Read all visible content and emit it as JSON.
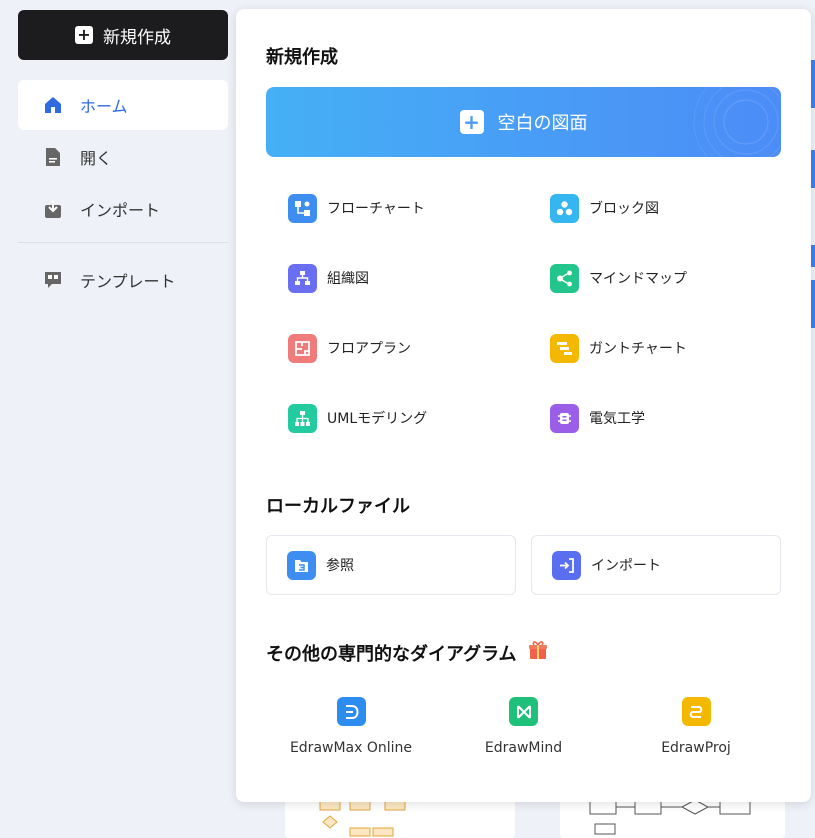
{
  "sidebar": {
    "new_button_label": "新規作成",
    "items": [
      {
        "label": "ホーム",
        "active": true
      },
      {
        "label": "開く"
      },
      {
        "label": "インポート"
      },
      {
        "label": "テンプレート"
      }
    ]
  },
  "panel": {
    "new_title": "新規作成",
    "blank_label": "空白の図面",
    "types": [
      {
        "label": "フローチャート",
        "icon": "flowchart-icon",
        "color": "#3d8ef0"
      },
      {
        "label": "ブロック図",
        "icon": "block-diagram-icon",
        "color": "#35b6f0"
      },
      {
        "label": "組織図",
        "icon": "org-chart-icon",
        "color": "#6a6ef0"
      },
      {
        "label": "マインドマップ",
        "icon": "mindmap-icon",
        "color": "#22c58b"
      },
      {
        "label": "フロアプラン",
        "icon": "floor-plan-icon",
        "color": "#f07b7b"
      },
      {
        "label": "ガントチャート",
        "icon": "gantt-icon",
        "color": "#f5b800"
      },
      {
        "label": "UMLモデリング",
        "icon": "uml-icon",
        "color": "#22cba0"
      },
      {
        "label": "電気工学",
        "icon": "electrical-icon",
        "color": "#9a5ee8"
      }
    ],
    "local_title": "ローカルファイル",
    "local": [
      {
        "label": "参照",
        "icon": "browse-icon",
        "color": "#3d8ef0"
      },
      {
        "label": "インポート",
        "icon": "import-icon",
        "color": "#5a6ef0"
      }
    ],
    "other_title": "その他の専門的なダイアグラム",
    "apps": [
      {
        "label": "EdrawMax Online",
        "icon": "edrawmax-icon",
        "color": "#2d8cf0"
      },
      {
        "label": "EdrawMind",
        "icon": "edrawmind-icon",
        "color": "#1fc07a"
      },
      {
        "label": "EdrawProj",
        "icon": "edrawproj-icon",
        "color": "#f5b800"
      }
    ]
  }
}
